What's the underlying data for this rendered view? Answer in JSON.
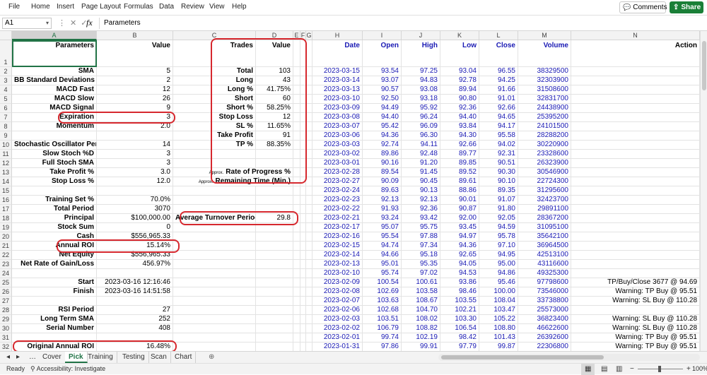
{
  "menu": [
    "File",
    "Home",
    "Insert",
    "Page Layout",
    "Formulas",
    "Data",
    "Review",
    "View",
    "Help"
  ],
  "buttons": {
    "comments": "Comments",
    "share": "Share"
  },
  "formula_bar": {
    "name_box": "A1",
    "fx": "fx",
    "content": "Parameters"
  },
  "columns": [
    "A",
    "B",
    "C",
    "D",
    "E",
    "F",
    "G",
    "H",
    "I",
    "J",
    "K",
    "L",
    "M",
    "N"
  ],
  "selected_column": "A",
  "rows": [
    "1",
    "2",
    "3",
    "4",
    "5",
    "6",
    "7",
    "8",
    "9",
    "10",
    "11",
    "12",
    "13",
    "14",
    "15",
    "16",
    "17",
    "18",
    "19",
    "20",
    "21",
    "22",
    "23",
    "24",
    "25",
    "26",
    "27",
    "28",
    "29",
    "30",
    "31",
    "32"
  ],
  "headers": {
    "param": "Parameters",
    "value": "Value",
    "trades": "Trades",
    "tvalue": "Value",
    "date": "Date",
    "open": "Open",
    "high": "High",
    "low": "Low",
    "close": "Close",
    "volume": "Volume",
    "action": "Action"
  },
  "params": [
    {
      "row": 2,
      "label": "SMA",
      "value": "5"
    },
    {
      "row": 3,
      "label": "BB Standard Deviations",
      "value": "2"
    },
    {
      "row": 4,
      "label": "MACD Fast",
      "value": "12"
    },
    {
      "row": 5,
      "label": "MACD Slow",
      "value": "26"
    },
    {
      "row": 6,
      "label": "MACD Signal",
      "value": "9"
    },
    {
      "row": 7,
      "label": "Expiration",
      "value": "3"
    },
    {
      "row": 8,
      "label": "Momentum",
      "value": "2.0"
    },
    {
      "row": 10,
      "label": "Stochastic Oscillator Period",
      "value": "14"
    },
    {
      "row": 11,
      "label": "Slow Stoch %D",
      "value": "3"
    },
    {
      "row": 12,
      "label": "Full Stoch SMA",
      "value": "3"
    },
    {
      "row": 13,
      "label": "Take Profit %",
      "value": "3.0"
    },
    {
      "row": 14,
      "label": "Stop Loss %",
      "value": "12.0"
    },
    {
      "row": 16,
      "label": "Training Set %",
      "value": "70.0%"
    },
    {
      "row": 17,
      "label": "Total Period",
      "value": "3070"
    },
    {
      "row": 18,
      "label": "Principal",
      "value": "$100,000.00"
    },
    {
      "row": 19,
      "label": "Stock Sum",
      "value": "0"
    },
    {
      "row": 20,
      "label": "Cash",
      "value": "$556,965.33"
    },
    {
      "row": 21,
      "label": "Annual ROI",
      "value": "15.14%"
    },
    {
      "row": 22,
      "label": "Net Equity",
      "value": "$556,965.33"
    },
    {
      "row": 23,
      "label": "Net Rate of Gain/Loss",
      "value": "456.97%"
    },
    {
      "row": 25,
      "label": "Start",
      "value": "2023-03-16 12:16:46"
    },
    {
      "row": 26,
      "label": "Finish",
      "value": "2023-03-16 14:51:58"
    },
    {
      "row": 28,
      "label": "RSI Period",
      "value": "27"
    },
    {
      "row": 29,
      "label": "Long Term SMA",
      "value": "252"
    },
    {
      "row": 30,
      "label": "Serial Number",
      "value": "408"
    },
    {
      "row": 32,
      "label": "Original Annual ROI",
      "value": "16.48%"
    }
  ],
  "trades": [
    {
      "row": 2,
      "label": "Total",
      "value": "103"
    },
    {
      "row": 3,
      "label": "Long",
      "value": "43"
    },
    {
      "row": 4,
      "label": "Long %",
      "value": "41.75%"
    },
    {
      "row": 5,
      "label": "Short",
      "value": "60"
    },
    {
      "row": 6,
      "label": "Short %",
      "value": "58.25%"
    },
    {
      "row": 7,
      "label": "Stop Loss",
      "value": "12"
    },
    {
      "row": 8,
      "label": "SL %",
      "value": "11.65%"
    },
    {
      "row": 9,
      "label": "Take Profit",
      "value": "91"
    },
    {
      "row": 10,
      "label": "TP %",
      "value": "88.35%"
    }
  ],
  "progress": {
    "approx": "Approx.",
    "rate_label": "Rate of Progress %",
    "time_label": "Remaining Time (Min.)"
  },
  "turnover": {
    "label": "Average Turnover Period",
    "value": "29.8"
  },
  "prices": [
    [
      "2023-03-15",
      "93.54",
      "97.25",
      "93.04",
      "96.55",
      "38329500",
      ""
    ],
    [
      "2023-03-14",
      "93.07",
      "94.83",
      "92.78",
      "94.25",
      "32303900",
      ""
    ],
    [
      "2023-03-13",
      "90.57",
      "93.08",
      "89.94",
      "91.66",
      "31508600",
      ""
    ],
    [
      "2023-03-10",
      "92.50",
      "93.18",
      "90.80",
      "91.01",
      "32831700",
      ""
    ],
    [
      "2023-03-09",
      "94.49",
      "95.92",
      "92.36",
      "92.66",
      "24438900",
      ""
    ],
    [
      "2023-03-08",
      "94.40",
      "96.24",
      "94.40",
      "94.65",
      "25395200",
      ""
    ],
    [
      "2023-03-07",
      "95.42",
      "96.09",
      "93.84",
      "94.17",
      "24101500",
      ""
    ],
    [
      "2023-03-06",
      "94.36",
      "96.30",
      "94.30",
      "95.58",
      "28288200",
      ""
    ],
    [
      "2023-03-03",
      "92.74",
      "94.11",
      "92.66",
      "94.02",
      "30220900",
      ""
    ],
    [
      "2023-03-02",
      "89.86",
      "92.48",
      "89.77",
      "92.31",
      "23328600",
      ""
    ],
    [
      "2023-03-01",
      "90.16",
      "91.20",
      "89.85",
      "90.51",
      "26323900",
      ""
    ],
    [
      "2023-02-28",
      "89.54",
      "91.45",
      "89.52",
      "90.30",
      "30546900",
      ""
    ],
    [
      "2023-02-27",
      "90.09",
      "90.45",
      "89.61",
      "90.10",
      "22724300",
      ""
    ],
    [
      "2023-02-24",
      "89.63",
      "90.13",
      "88.86",
      "89.35",
      "31295600",
      ""
    ],
    [
      "2023-02-23",
      "92.13",
      "92.13",
      "90.01",
      "91.07",
      "32423700",
      ""
    ],
    [
      "2023-02-22",
      "91.93",
      "92.36",
      "90.87",
      "91.80",
      "29891100",
      ""
    ],
    [
      "2023-02-21",
      "93.24",
      "93.42",
      "92.00",
      "92.05",
      "28367200",
      ""
    ],
    [
      "2023-02-17",
      "95.07",
      "95.75",
      "93.45",
      "94.59",
      "31095100",
      ""
    ],
    [
      "2023-02-16",
      "95.54",
      "97.88",
      "94.97",
      "95.78",
      "35642100",
      ""
    ],
    [
      "2023-02-15",
      "94.74",
      "97.34",
      "94.36",
      "97.10",
      "36964500",
      ""
    ],
    [
      "2023-02-14",
      "94.66",
      "95.18",
      "92.65",
      "94.95",
      "42513100",
      ""
    ],
    [
      "2023-02-13",
      "95.01",
      "95.35",
      "94.05",
      "95.00",
      "43116600",
      ""
    ],
    [
      "2023-02-10",
      "95.74",
      "97.02",
      "94.53",
      "94.86",
      "49325300",
      ""
    ],
    [
      "2023-02-09",
      "100.54",
      "100.61",
      "93.86",
      "95.46",
      "97798600",
      "TP/Buy/Close 3677 @ 94.69"
    ],
    [
      "2023-02-08",
      "102.69",
      "103.58",
      "98.46",
      "100.00",
      "73546000",
      "Warning: TP Buy @ 95.51"
    ],
    [
      "2023-02-07",
      "103.63",
      "108.67",
      "103.55",
      "108.04",
      "33738800",
      "Warning: SL Buy @ 110.28"
    ],
    [
      "2023-02-06",
      "102.68",
      "104.70",
      "102.21",
      "103.47",
      "25573000",
      ""
    ],
    [
      "2023-02-03",
      "103.51",
      "108.02",
      "103.30",
      "105.22",
      "36823400",
      "Warning: SL Buy @ 110.28"
    ],
    [
      "2023-02-02",
      "106.79",
      "108.82",
      "106.54",
      "108.80",
      "46622600",
      "Warning: SL Buy @ 110.28"
    ],
    [
      "2023-02-01",
      "99.74",
      "102.19",
      "98.42",
      "101.43",
      "26392600",
      "Warning: TP Buy @ 95.51"
    ],
    [
      "2023-01-31",
      "97.86",
      "99.91",
      "97.79",
      "99.87",
      "22306800",
      "Warning: TP Buy @ 95.51"
    ]
  ],
  "sheets": [
    "Cover",
    "Pick",
    "Training",
    "Testing",
    "Scan",
    "Chart"
  ],
  "active_sheet": "Pick",
  "status": {
    "ready": "Ready",
    "accessibility": "Accessibility: Investigate",
    "zoom": "100%"
  }
}
